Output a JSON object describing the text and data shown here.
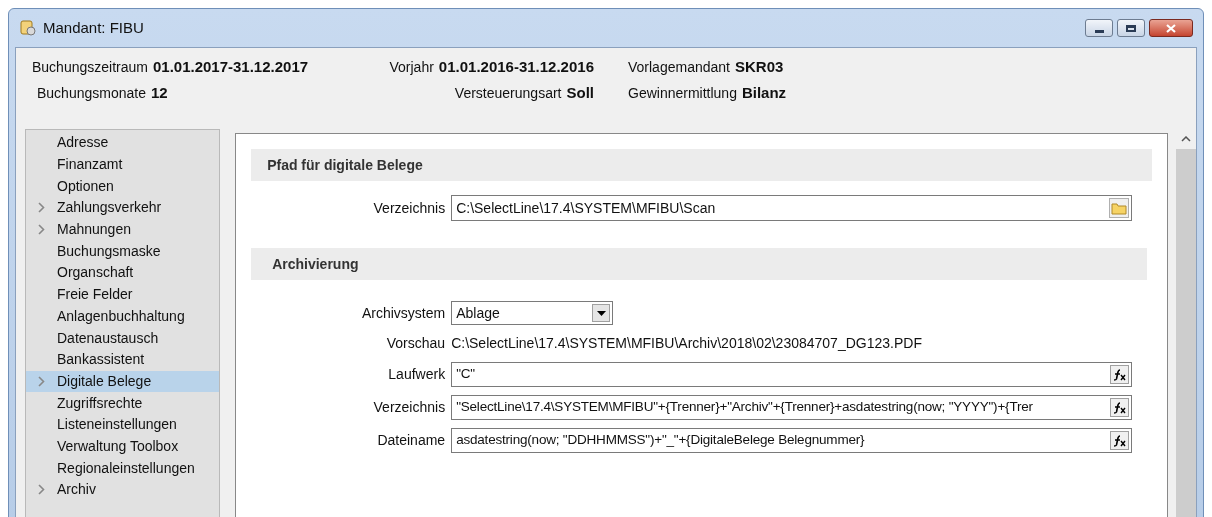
{
  "window": {
    "title": "Mandant: FIBU"
  },
  "header": {
    "rows": [
      [
        {
          "label": "Buchungszeitraum",
          "value": "01.01.2017-31.12.2017"
        },
        {
          "label": "Vorjahr",
          "value": "01.01.2016-31.12.2016"
        },
        {
          "label": "Vorlagemandant",
          "value": "SKR03"
        }
      ],
      [
        {
          "label": "Buchungsmonate",
          "value": "12"
        },
        {
          "label": "Versteuerungsart",
          "value": "Soll"
        },
        {
          "label": "Gewinnermittlung",
          "value": "Bilanz"
        }
      ]
    ]
  },
  "sidebar": {
    "items": [
      {
        "label": "Adresse",
        "expandable": false,
        "selected": false
      },
      {
        "label": "Finanzamt",
        "expandable": false,
        "selected": false
      },
      {
        "label": "Optionen",
        "expandable": false,
        "selected": false
      },
      {
        "label": "Zahlungsverkehr",
        "expandable": true,
        "selected": false
      },
      {
        "label": "Mahnungen",
        "expandable": true,
        "selected": false
      },
      {
        "label": "Buchungsmaske",
        "expandable": false,
        "selected": false
      },
      {
        "label": "Organschaft",
        "expandable": false,
        "selected": false
      },
      {
        "label": "Freie Felder",
        "expandable": false,
        "selected": false
      },
      {
        "label": "Anlagenbuchhaltung",
        "expandable": false,
        "selected": false
      },
      {
        "label": "Datenaustausch",
        "expandable": false,
        "selected": false
      },
      {
        "label": "Bankassistent",
        "expandable": false,
        "selected": false
      },
      {
        "label": "Digitale Belege",
        "expandable": true,
        "selected": true
      },
      {
        "label": "Zugriffsrechte",
        "expandable": false,
        "selected": false
      },
      {
        "label": "Listeneinstellungen",
        "expandable": false,
        "selected": false
      },
      {
        "label": "Verwaltung Toolbox",
        "expandable": false,
        "selected": false
      },
      {
        "label": "Regionaleinstellungen",
        "expandable": false,
        "selected": false
      },
      {
        "label": "Archiv",
        "expandable": true,
        "selected": false
      }
    ]
  },
  "sections": [
    {
      "title": "Pfad für digitale Belege",
      "fields": [
        {
          "kind": "browse",
          "label": "Verzeichnis",
          "value": "C:\\SelectLine\\17.4\\SYSTEM\\MFIBU\\Scan"
        }
      ]
    },
    {
      "title": "Archivierung",
      "fields": [
        {
          "kind": "select",
          "label": "Archivsystem",
          "value": "Ablage"
        },
        {
          "kind": "readonly",
          "label": "Vorschau",
          "value": "C:\\SelectLine\\17.4\\SYSTEM\\MFIBU\\Archiv\\2018\\02\\23084707_DG123.PDF"
        },
        {
          "kind": "formula",
          "label": "Laufwerk",
          "value": "\"C\""
        },
        {
          "kind": "formula",
          "label": "Verzeichnis",
          "value": "\"SelectLine\\17.4\\SYSTEM\\MFIBU\"+{Trenner}+\"Archiv\"+{Trenner}+asdatestring(now; \"YYYY\")+{Trer"
        },
        {
          "kind": "formula",
          "label": "Dateiname",
          "value": "asdatestring(now; \"DDHHMMSS\")+\"_\"+{DigitaleBelege Belegnummer}"
        }
      ]
    }
  ]
}
